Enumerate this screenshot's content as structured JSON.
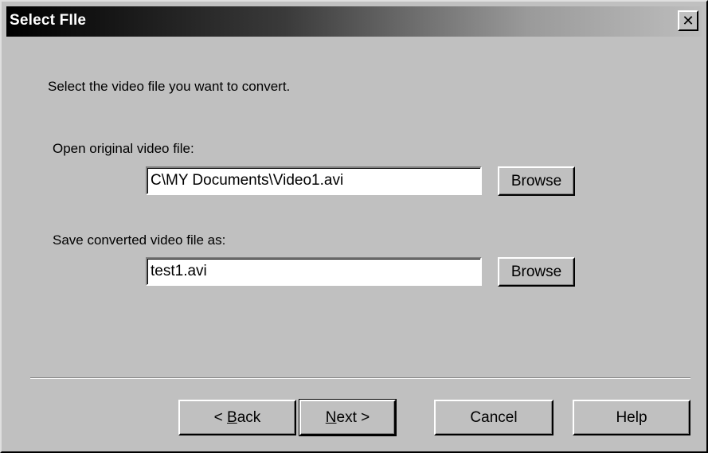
{
  "window": {
    "title": "Select FIle",
    "close_glyph": "✕"
  },
  "instructions": "Select the video file you want to convert.",
  "open_section": {
    "label": "Open original video file:",
    "value": "C\\MY Documents\\Video1.avi",
    "browse_label": "Browse"
  },
  "save_section": {
    "label": "Save converted video file as:",
    "value": "test1.avi",
    "browse_label": "Browse"
  },
  "footer": {
    "back_prefix": "< ",
    "back_mnemonic": "B",
    "back_rest": "ack",
    "next_mnemonic": "N",
    "next_rest": "ext >",
    "cancel_label": "Cancel",
    "help_label": "Help"
  }
}
